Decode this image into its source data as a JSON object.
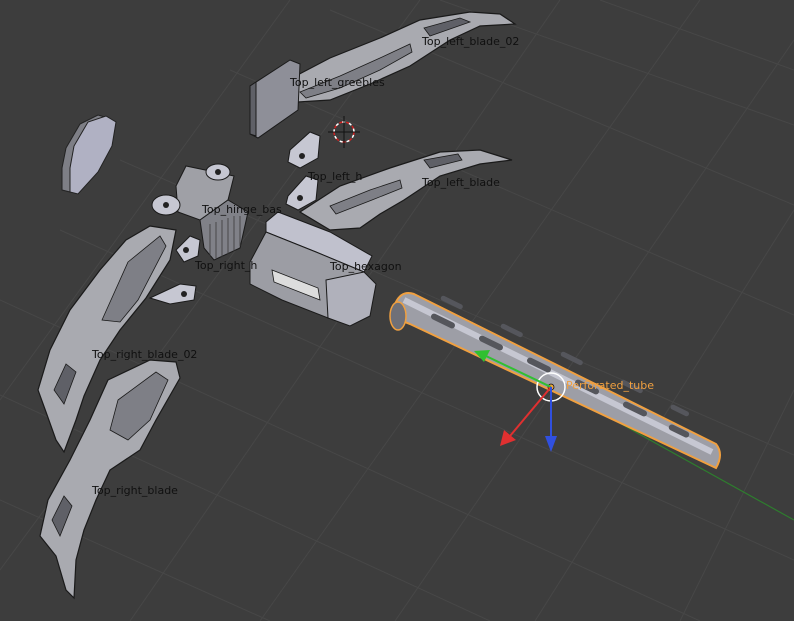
{
  "app": "Blender 3D Viewport",
  "colors": {
    "background": "#3d3d3d",
    "grid": "#474747",
    "mesh_fill": "#a9aab0",
    "mesh_shade": "#7e7f86",
    "mesh_dark": "#5f6067",
    "selection_outline": "#f0a040",
    "axis_x": "#e03030",
    "axis_y": "#30c030",
    "axis_z": "#3050e0",
    "label": "#101010",
    "label_selected": "#f0a040"
  },
  "objects": [
    {
      "label": "Top_left_blade_02",
      "selected": false
    },
    {
      "label": "Top_left_greebles",
      "selected": false
    },
    {
      "label": "Top_left_h",
      "selected": false
    },
    {
      "label": "Top_left_blade",
      "selected": false
    },
    {
      "label": "Top_hinge_bas",
      "selected": false
    },
    {
      "label": "Top_right_h",
      "selected": false
    },
    {
      "label": "Top_hexagon",
      "selected": false
    },
    {
      "label": "Top_right_blade_02",
      "selected": false
    },
    {
      "label": "Top_right_blade",
      "selected": false
    },
    {
      "label": "Perforated_tube",
      "selected": true
    }
  ],
  "gizmo_icons": [
    "3d-cursor-icon",
    "move-gizmo-x-arrow-icon",
    "move-gizmo-y-arrow-icon",
    "move-gizmo-z-arrow-icon"
  ]
}
